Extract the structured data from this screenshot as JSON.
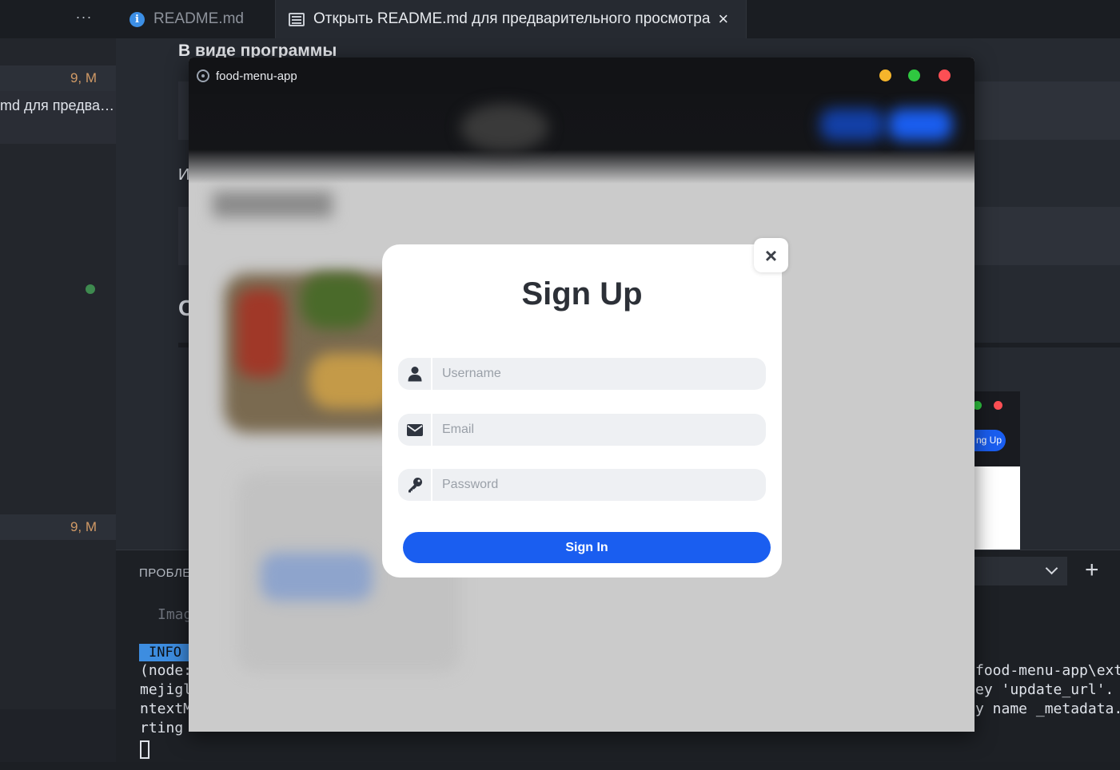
{
  "tabs": {
    "more": "···",
    "readme_label": "README.md",
    "preview_label": "Открыть README.md для предварительного просмотра",
    "close_glyph": "×"
  },
  "explorer": {
    "badge_top": "9, M",
    "file_label": "md для предва…",
    "badge_bottom": "9, M"
  },
  "markdown": {
    "heading": "В виде программы",
    "fragment_i": "И",
    "fragment_c": "С"
  },
  "panel": {
    "label": "ПРОБЛЕ",
    "term_img": "Imag",
    "info_badge": "INFO",
    "term_left": [
      "(node:",
      "mejigl",
      "ntextM",
      "rting"
    ],
    "term_right": [
      "food-menu-app\\ext",
      "ey 'update_url'.",
      "y name _metadata."
    ]
  },
  "mini_window": {
    "button_label": "ng Up"
  },
  "app": {
    "title": "food-menu-app",
    "colors": {
      "minimize": "#f6b52b",
      "maximize": "#2fc840",
      "close": "#fd4f54",
      "primary": "#1a5ef0"
    }
  },
  "modal": {
    "title": "Sign Up",
    "close_glyph": "×",
    "username_placeholder": "Username",
    "email_placeholder": "Email",
    "password_placeholder": "Password",
    "submit_label": "Sign In",
    "icons": [
      "user-icon",
      "envelope-icon",
      "key-icon"
    ]
  }
}
